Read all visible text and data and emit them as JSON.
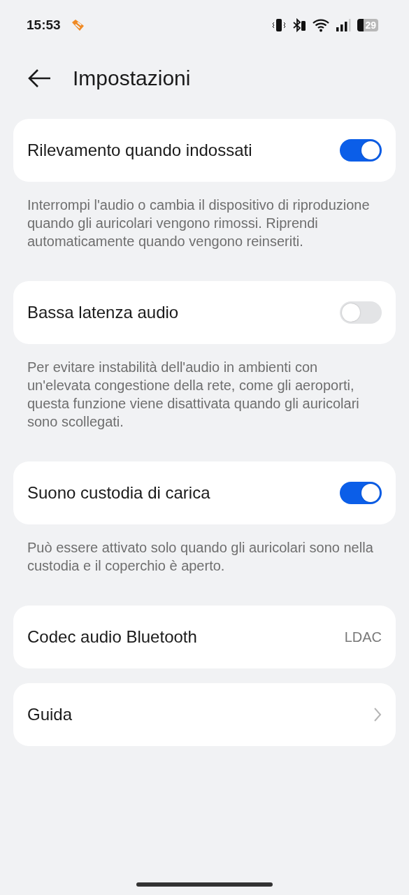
{
  "status_bar": {
    "time": "15:53",
    "battery": "29"
  },
  "header": {
    "title": "Impostazioni"
  },
  "settings": [
    {
      "kind": "toggle",
      "label": "Rilevamento quando indossati",
      "on": true,
      "description": "Interrompi l'audio o cambia il dispositivo di riproduzione quando gli auricolari vengono rimossi. Riprendi automaticamente quando vengono reinseriti."
    },
    {
      "kind": "toggle",
      "label": "Bassa latenza audio",
      "on": false,
      "description": "Per evitare instabilità dell'audio in ambienti con un'elevata congestione della rete, come gli aeroporti, questa funzione viene disattivata quando gli auricolari sono scollegati."
    },
    {
      "kind": "toggle",
      "label": "Suono custodia di carica",
      "on": true,
      "description": "Può essere attivato solo quando gli auricolari sono nella custodia e il coperchio è aperto."
    },
    {
      "kind": "value",
      "label": "Codec audio Bluetooth",
      "value": "LDAC"
    },
    {
      "kind": "link",
      "label": "Guida"
    }
  ]
}
